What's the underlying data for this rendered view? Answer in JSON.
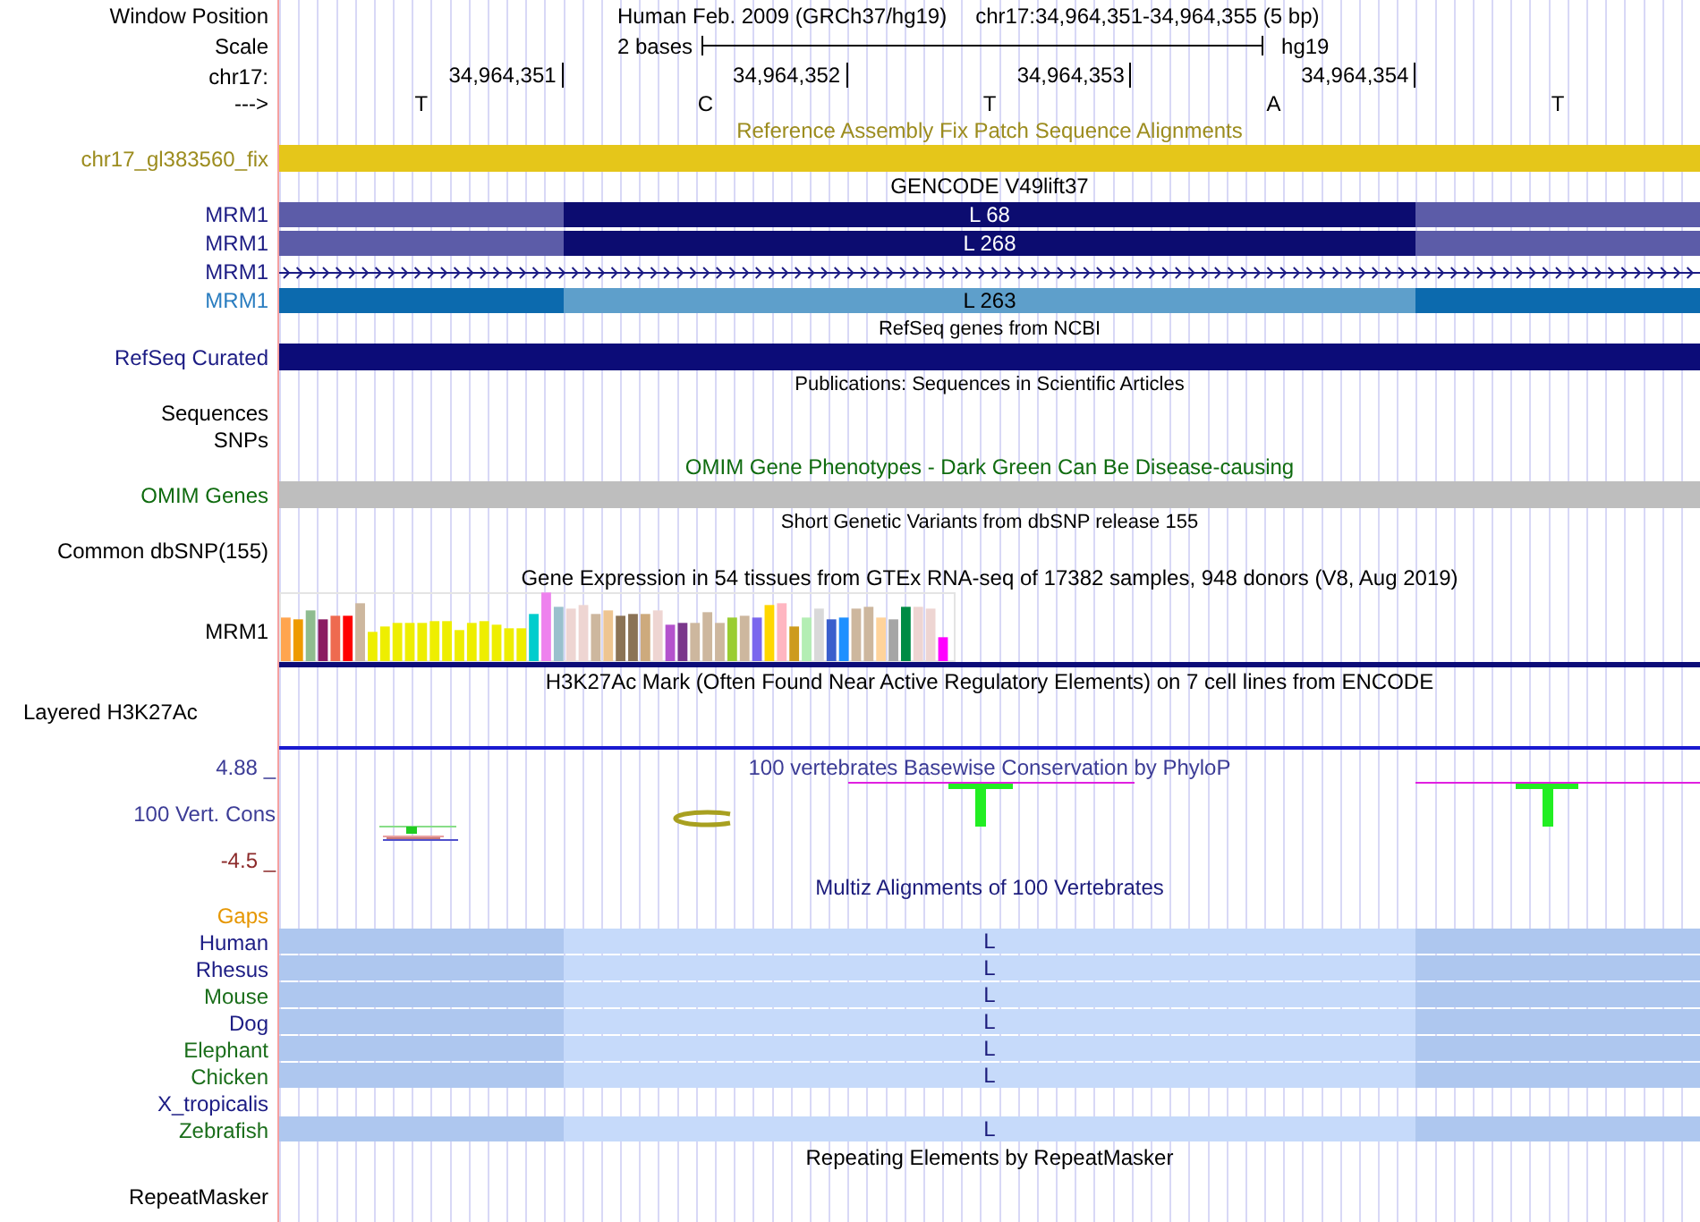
{
  "header": {
    "position": {
      "label": "Window Position",
      "assembly": "Human Feb. 2009 (GRCh37/hg19)",
      "range": "chr17:34,964,351-34,964,355 (5 bp)"
    },
    "scale": {
      "label": "Scale",
      "span": "2 bases",
      "db": "hg19"
    },
    "ruler": {
      "label": "chr17:",
      "ticks": [
        "34,964,351",
        "34,964,352",
        "34,964,353",
        "34,964,354"
      ]
    },
    "strand": {
      "label": "--->",
      "bases": [
        "T",
        "C",
        "T",
        "A",
        "T"
      ]
    }
  },
  "rows": [
    {
      "kind": "title",
      "text": "Reference Assembly Fix Patch Sequence Alignments",
      "color": "#9c8c1e"
    },
    {
      "kind": "bar",
      "label": {
        "text": "chr17_gl383560_fix",
        "color": "#9c8c1e"
      },
      "bar": {
        "color": "#e5c61a"
      }
    },
    {
      "kind": "title",
      "text": "GENCODE V49lift37"
    },
    {
      "kind": "gene",
      "label": {
        "text": "MRM1",
        "color": "#1c1c84"
      },
      "segments": [
        {
          "color": "#5c5ca8"
        },
        {
          "color": "#0c0c70",
          "text": "L 68"
        },
        {
          "color": "#5c5ca8"
        }
      ]
    },
    {
      "kind": "gene",
      "label": {
        "text": "MRM1",
        "color": "#1c1c84"
      },
      "segments": [
        {
          "color": "#5c5ca8"
        },
        {
          "color": "#0c0c70",
          "text": "L 268"
        },
        {
          "color": "#5c5ca8"
        }
      ]
    },
    {
      "kind": "strand",
      "label": {
        "text": "MRM1",
        "color": "#1c1c84"
      }
    },
    {
      "kind": "gene",
      "label": {
        "text": "MRM1",
        "color": "#2a7dc0"
      },
      "segments": [
        {
          "color": "#0c6aae"
        },
        {
          "color": "#5e9fcb",
          "text": "L 263"
        },
        {
          "color": "#0c6aae"
        }
      ]
    },
    {
      "kind": "caption",
      "text": "RefSeq genes from NCBI"
    },
    {
      "kind": "bar",
      "label": {
        "text": "RefSeq Curated",
        "color": "#1c1c84"
      },
      "bar": {
        "color": "#0c0c78"
      }
    },
    {
      "kind": "caption",
      "text": "Publications: Sequences in Scientific Articles"
    },
    {
      "kind": "empty",
      "label": {
        "text": "Sequences"
      }
    },
    {
      "kind": "empty",
      "label": {
        "text": "SNPs"
      }
    },
    {
      "kind": "title",
      "text": "OMIM Gene Phenotypes - Dark Green Can Be Disease-causing",
      "color": "#0f6b0f"
    },
    {
      "kind": "bar",
      "label": {
        "text": "OMIM Genes",
        "color": "#0f6b0f"
      },
      "bar": {
        "color": "#bebebe"
      }
    },
    {
      "kind": "caption",
      "text": "Short Genetic Variants from dbSNP release 155"
    },
    {
      "kind": "empty",
      "label": {
        "text": "Common dbSNP(155)"
      }
    },
    {
      "kind": "title",
      "text": "Gene Expression in 54 tissues from GTEx RNA-seq of 17382 samples, 948 donors (V8, Aug 2019)"
    },
    {
      "kind": "expression",
      "label": {
        "text": "MRM1"
      }
    },
    {
      "kind": "title",
      "text": "H3K27Ac Mark (Often Found Near Active Regulatory Elements) on 7 cell lines from ENCODE"
    },
    {
      "kind": "layered",
      "label": {
        "text": "Layered H3K27Ac"
      }
    },
    {
      "kind": "wiggle",
      "label": {
        "text": "100 Vert. Cons",
        "color": "#3c3c96"
      },
      "title": {
        "text": "100 vertebrates Basewise Conservation by PhyloP",
        "color": "#3c3c96"
      },
      "max": {
        "text": "4.88 _",
        "color": "#3c3c96"
      },
      "min": {
        "text": "-4.5 _",
        "color": "#8c2a2a"
      }
    },
    {
      "kind": "title",
      "text": "Multiz Alignments of 100 Vertebrates",
      "color": "#1c1c7c"
    },
    {
      "kind": "empty",
      "label": {
        "text": "Gaps",
        "color": "#e69600"
      }
    },
    {
      "kind": "alignment",
      "label": {
        "text": "Human",
        "color": "#1c1c84"
      },
      "segments": [
        {
          "color": "#aec7ef"
        },
        {
          "color": "#c6dafa",
          "text": "L"
        },
        {
          "color": "#aec7ef"
        }
      ]
    },
    {
      "kind": "alignment",
      "label": {
        "text": "Rhesus",
        "color": "#1c1c84"
      },
      "segments": [
        {
          "color": "#aec7ef"
        },
        {
          "color": "#c6dafa",
          "text": "L"
        },
        {
          "color": "#aec7ef"
        }
      ]
    },
    {
      "kind": "alignment",
      "label": {
        "text": "Mouse",
        "color": "#1b6e1b"
      },
      "segments": [
        {
          "color": "#aec7ef"
        },
        {
          "color": "#c6dafa",
          "text": "L"
        },
        {
          "color": "#aec7ef"
        }
      ]
    },
    {
      "kind": "alignment",
      "label": {
        "text": "Dog",
        "color": "#1c1c84"
      },
      "segments": [
        {
          "color": "#aec7ef"
        },
        {
          "color": "#c6dafa",
          "text": "L"
        },
        {
          "color": "#aec7ef"
        }
      ]
    },
    {
      "kind": "alignment",
      "label": {
        "text": "Elephant",
        "color": "#1b6e1b"
      },
      "segments": [
        {
          "color": "#aec7ef"
        },
        {
          "color": "#c6dafa",
          "text": "L"
        },
        {
          "color": "#aec7ef"
        }
      ]
    },
    {
      "kind": "alignment",
      "label": {
        "text": "Chicken",
        "color": "#1b6e1b"
      },
      "segments": [
        {
          "color": "#aec7ef"
        },
        {
          "color": "#c6dafa",
          "text": "L"
        },
        {
          "color": "#aec7ef"
        }
      ]
    },
    {
      "kind": "empty",
      "label": {
        "text": "X_tropicalis",
        "color": "#1c1c84"
      }
    },
    {
      "kind": "alignment",
      "label": {
        "text": "Zebrafish",
        "color": "#1b6e1b"
      },
      "segments": [
        {
          "color": "#aec7ef"
        },
        {
          "color": "#c6dafa",
          "text": "L"
        },
        {
          "color": "#aec7ef"
        }
      ]
    },
    {
      "kind": "title",
      "text": "Repeating Elements by RepeatMasker"
    },
    {
      "kind": "empty",
      "label": {
        "text": "RepeatMasker"
      }
    }
  ]
}
